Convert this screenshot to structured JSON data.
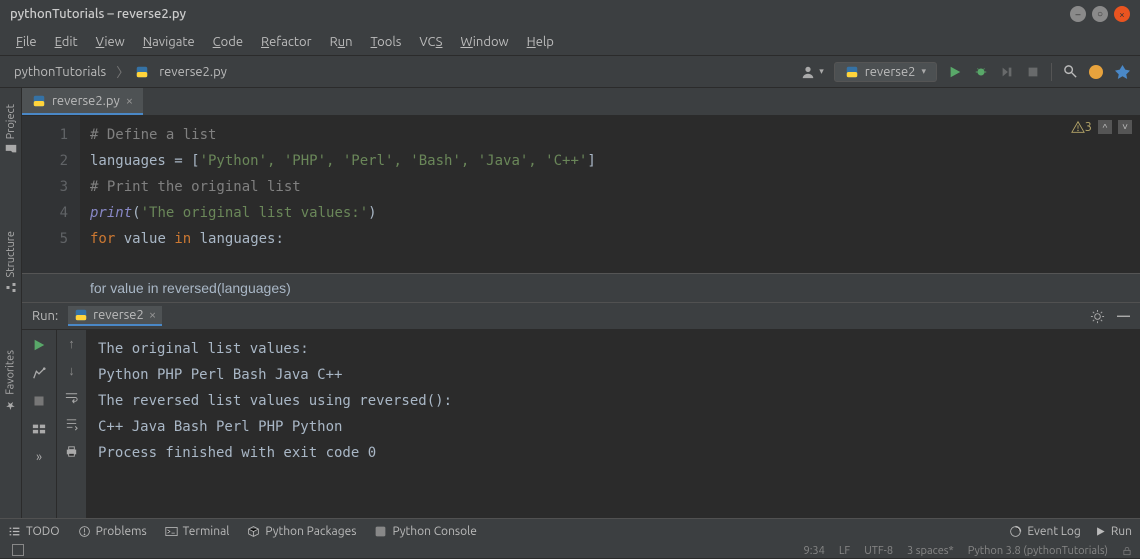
{
  "titlebar": {
    "title": "pythonTutorials – reverse2.py"
  },
  "menu": [
    "File",
    "Edit",
    "View",
    "Navigate",
    "Code",
    "Refactor",
    "Run",
    "Tools",
    "VCS",
    "Window",
    "Help"
  ],
  "breadcrumb": {
    "project": "pythonTutorials",
    "file": "reverse2.py"
  },
  "runconfig": {
    "name": "reverse2"
  },
  "tabs": [
    {
      "label": "reverse2.py"
    }
  ],
  "editor": {
    "lines": [
      "1",
      "2",
      "3",
      "4",
      "5"
    ],
    "l1_comment": "# Define a list",
    "l2_var": "languages",
    "l2_eq": " = [",
    "l2_vals": "'Python', 'PHP', 'Perl', 'Bash', 'Java', 'C++'",
    "l2_close": "]",
    "l3_comment": "# Print the original list",
    "l4_fn": "print",
    "l4_arg": "'The original list values:'",
    "l5_for": "for",
    "l5_in": "in",
    "l5_var": "value",
    "l5_iter": "languages",
    "l5_colon": ":",
    "warning_count": "3",
    "completion_hint": "for value in reversed(languages)"
  },
  "run": {
    "label": "Run:",
    "tab": "reverse2",
    "lines": [
      "The original list values:",
      "Python  PHP Perl   Bash   Java   C++",
      "The reversed list values using reversed():",
      "C++ Java   Bash   Perl   PHP Python",
      "Process finished with exit code 0"
    ]
  },
  "bottom": {
    "todo": "TODO",
    "problems": "Problems",
    "terminal": "Terminal",
    "packages": "Python Packages",
    "console": "Python Console",
    "eventlog": "Event Log",
    "runbtn": "Run"
  },
  "status": {
    "pos": "9:34",
    "le": "LF",
    "enc": "UTF-8",
    "indent": "3 spaces*",
    "sdk": "Python 3.8 (pythonTutorials)"
  },
  "rails": {
    "project": "Project",
    "structure": "Structure",
    "favorites": "Favorites"
  }
}
